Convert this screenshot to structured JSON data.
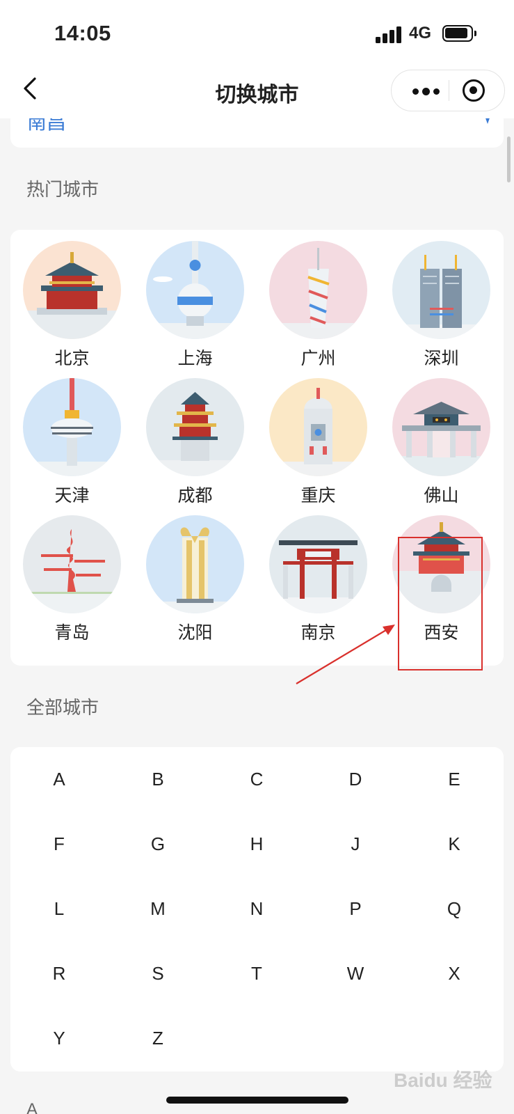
{
  "status_bar": {
    "time": "14:05",
    "network": "4G"
  },
  "nav": {
    "title": "切换城市"
  },
  "current": {
    "city": "南昌"
  },
  "hot_section": {
    "label": "热门城市"
  },
  "hot_cities": [
    {
      "name": "北京"
    },
    {
      "name": "上海"
    },
    {
      "name": "广州"
    },
    {
      "name": "深圳"
    },
    {
      "name": "天津"
    },
    {
      "name": "成都"
    },
    {
      "name": "重庆"
    },
    {
      "name": "佛山"
    },
    {
      "name": "青岛"
    },
    {
      "name": "沈阳"
    },
    {
      "name": "南京"
    },
    {
      "name": "西安"
    }
  ],
  "all_section": {
    "label": "全部城市"
  },
  "letters": [
    "A",
    "B",
    "C",
    "D",
    "E",
    "F",
    "G",
    "H",
    "J",
    "K",
    "L",
    "M",
    "N",
    "P",
    "Q",
    "R",
    "S",
    "T",
    "W",
    "X",
    "Y",
    "Z"
  ],
  "list_header": "A",
  "watermark": "Baidu 经验",
  "colors": {
    "accent_blue": "#3a7bd5",
    "highlight_red": "#d9302c"
  }
}
